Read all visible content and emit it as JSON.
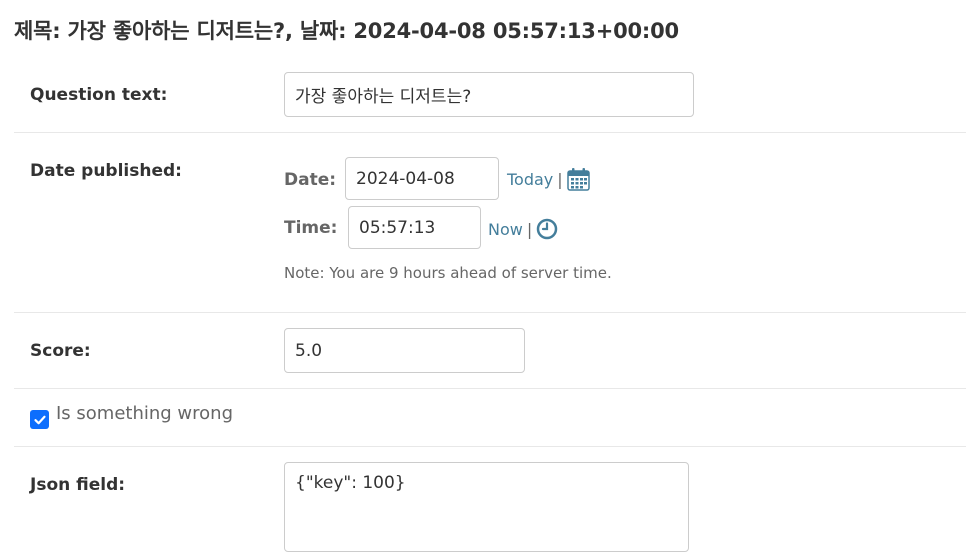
{
  "page": {
    "title": "제목: 가장 좋아하는 디저트는?, 날짜: 2024-04-08 05:57:13+00:00"
  },
  "question_text": {
    "label": "Question text:",
    "value": "가장 좋아하는 디저트는?"
  },
  "date_published": {
    "label": "Date published:",
    "date_label": "Date:",
    "date_value": "2024-04-08",
    "today_link": "Today",
    "time_label": "Time:",
    "time_value": "05:57:13",
    "now_link": "Now",
    "separator": "|",
    "calendar_icon": "calendar-icon",
    "clock_icon": "clock-icon",
    "note": "Note: You are 9 hours ahead of server time."
  },
  "score": {
    "label": "Score:",
    "value": "5.0"
  },
  "is_something_wrong": {
    "label": "Is something wrong",
    "checked": true
  },
  "json_field": {
    "label": "Json field:",
    "value": "{\"key\": 100}"
  },
  "colors": {
    "link": "#447e9b",
    "checkbox_accent": "#0d6efd",
    "border": "#cccccc",
    "divider": "#e8e8e8"
  }
}
